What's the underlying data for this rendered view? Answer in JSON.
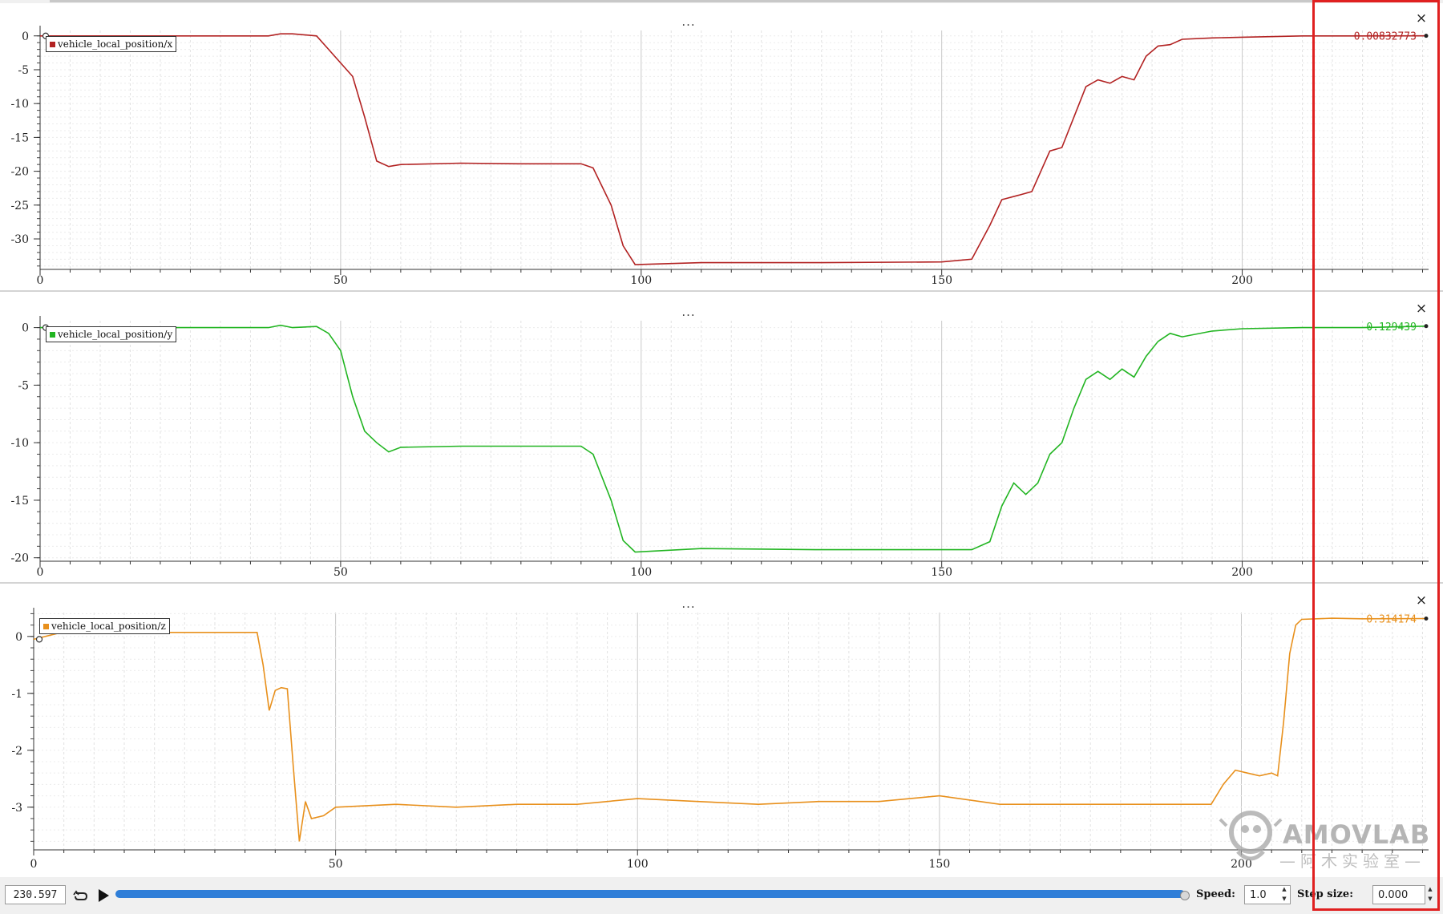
{
  "plots": [
    {
      "legend": "vehicle_local_position/x",
      "series_color": "#b22222",
      "current_value": "0.00832773",
      "ellipsis": "...",
      "close_label": "×",
      "x_ticks": [
        "0",
        "50",
        "100",
        "150",
        "200"
      ],
      "y_ticks": [
        "0",
        "-5",
        "-10",
        "-15",
        "-20",
        "-25",
        "-30"
      ]
    },
    {
      "legend": "vehicle_local_position/y",
      "series_color": "#22b522",
      "current_value": "0.129439",
      "ellipsis": "...",
      "close_label": "×",
      "x_ticks": [
        "0",
        "50",
        "100",
        "150",
        "200"
      ],
      "y_ticks": [
        "0",
        "-5",
        "-10",
        "-15",
        "-20"
      ]
    },
    {
      "legend": "vehicle_local_position/z",
      "series_color": "#e8901c",
      "current_value": "0.314174",
      "ellipsis": "...",
      "close_label": "×",
      "x_ticks": [
        "0",
        "50",
        "100",
        "150",
        "200"
      ],
      "y_ticks": [
        "0",
        "-1",
        "-2",
        "-3"
      ]
    }
  ],
  "chart_data": [
    {
      "type": "line",
      "series": [
        {
          "name": "vehicle_local_position/x",
          "x": [
            0,
            38,
            40,
            42,
            46,
            48,
            50,
            52,
            54,
            56,
            58,
            60,
            70,
            80,
            90,
            92,
            95,
            97,
            99,
            110,
            130,
            150,
            155,
            158,
            160,
            163,
            165,
            168,
            170,
            172,
            174,
            176,
            178,
            180,
            182,
            184,
            186,
            188,
            190,
            195,
            200,
            210,
            220,
            230.597
          ],
          "y": [
            0,
            0,
            0.3,
            0.3,
            0,
            -2,
            -4,
            -6,
            -12,
            -18.5,
            -19.3,
            -19,
            -18.8,
            -18.9,
            -18.9,
            -19.5,
            -25,
            -31,
            -33.8,
            -33.5,
            -33.5,
            -33.4,
            -33,
            -28,
            -24.2,
            -23.5,
            -23,
            -17,
            -16.5,
            -12,
            -7.5,
            -6.5,
            -7,
            -6,
            -6.5,
            -3,
            -1.5,
            -1.3,
            -0.5,
            -0.3,
            -0.2,
            0,
            0,
            0.00832773
          ]
        }
      ],
      "xlim": [
        0,
        231
      ],
      "ylim": [
        -34.5,
        0.8
      ]
    },
    {
      "type": "line",
      "series": [
        {
          "name": "vehicle_local_position/y",
          "x": [
            0,
            38,
            40,
            42,
            46,
            48,
            50,
            52,
            54,
            56,
            58,
            60,
            70,
            80,
            90,
            92,
            95,
            97,
            99,
            110,
            130,
            150,
            155,
            158,
            160,
            162,
            164,
            166,
            168,
            170,
            172,
            174,
            176,
            178,
            180,
            182,
            184,
            186,
            188,
            190,
            195,
            200,
            210,
            220,
            230.597
          ],
          "y": [
            0,
            0,
            0.2,
            0,
            0.1,
            -0.5,
            -2,
            -6,
            -9,
            -10,
            -10.8,
            -10.4,
            -10.3,
            -10.3,
            -10.3,
            -11,
            -15,
            -18.5,
            -19.5,
            -19.2,
            -19.3,
            -19.3,
            -19.3,
            -18.6,
            -15.5,
            -13.5,
            -14.5,
            -13.5,
            -11,
            -10,
            -7,
            -4.5,
            -3.8,
            -4.5,
            -3.6,
            -4.3,
            -2.5,
            -1.2,
            -0.5,
            -0.8,
            -0.3,
            -0.1,
            0,
            0,
            0.129439
          ]
        }
      ],
      "xlim": [
        0,
        231
      ],
      "ylim": [
        -20.3,
        0.6
      ]
    },
    {
      "type": "line",
      "series": [
        {
          "name": "vehicle_local_position/z",
          "x": [
            0,
            5,
            10,
            20,
            30,
            37,
            38,
            39,
            40,
            41,
            42,
            43,
            44,
            45,
            46,
            48,
            50,
            60,
            70,
            80,
            90,
            100,
            110,
            120,
            130,
            140,
            150,
            160,
            170,
            180,
            190,
            195,
            197,
            199,
            201,
            203,
            205,
            206,
            207,
            208,
            209,
            210,
            215,
            220,
            230.597
          ],
          "y": [
            -0.05,
            0.08,
            0.07,
            0.07,
            0.07,
            0.07,
            -0.5,
            -1.3,
            -0.95,
            -0.9,
            -0.92,
            -2.3,
            -3.6,
            -2.9,
            -3.2,
            -3.15,
            -3.0,
            -2.95,
            -3.0,
            -2.95,
            -2.95,
            -2.85,
            -2.9,
            -2.95,
            -2.9,
            -2.9,
            -2.8,
            -2.95,
            -2.95,
            -2.95,
            -2.95,
            -2.95,
            -2.6,
            -2.35,
            -2.4,
            -2.45,
            -2.4,
            -2.45,
            -1.5,
            -0.3,
            0.2,
            0.3,
            0.32,
            0.31,
            0.314174
          ]
        }
      ],
      "xlim": [
        0,
        231
      ],
      "ylim": [
        -3.75,
        0.42
      ]
    }
  ],
  "playback": {
    "time": "230.597",
    "progress": 1.0,
    "speed_label": "Speed:",
    "speed_value": "1.0",
    "step_label": "Step size:",
    "step_value": "0.000"
  },
  "watermark": {
    "brand": "AMOVLAB",
    "sub": "—阿木实验室—"
  }
}
